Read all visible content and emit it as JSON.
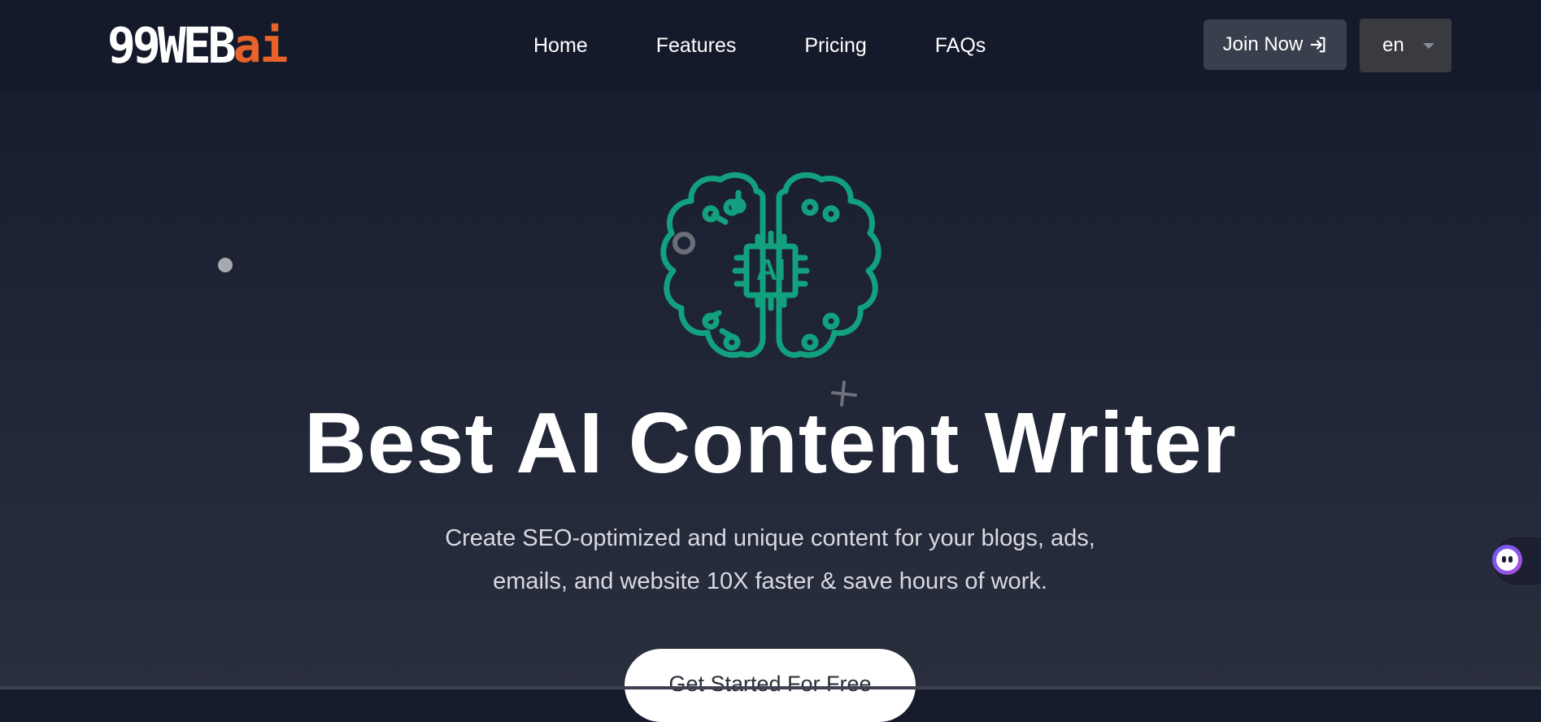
{
  "logo": {
    "main": "99WEB",
    "accent": "ai",
    "accent_color": "#e8622c"
  },
  "nav": {
    "links": [
      {
        "label": "Home"
      },
      {
        "label": "Features"
      },
      {
        "label": "Pricing"
      },
      {
        "label": "FAQs"
      }
    ],
    "join_label": "Join Now",
    "join_icon": "sign-in-icon",
    "language": "en"
  },
  "hero": {
    "icon": "ai-brain-circuit-icon",
    "icon_color": "#12a07f",
    "chip_label": "AI",
    "title": "Best AI Content Writer",
    "subtitle_line1": "Create SEO-optimized and unique content for your blogs, ads,",
    "subtitle_line2": "emails, and website 10X faster & save hours of work.",
    "cta_label": "Get Started For Free"
  },
  "chat_widget": {
    "icon": "chat-bot-icon"
  }
}
